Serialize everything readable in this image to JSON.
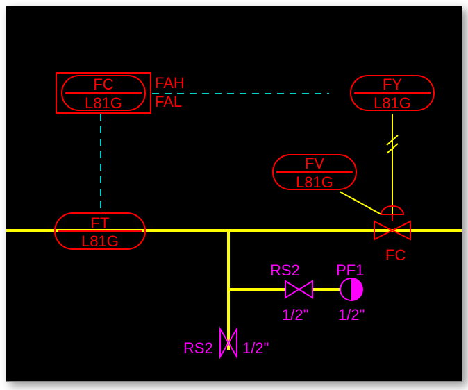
{
  "instruments": {
    "fc": {
      "type": "FC",
      "tag": "L81G"
    },
    "fy": {
      "type": "FY",
      "tag": "L81G"
    },
    "fv": {
      "type": "FV",
      "tag": "L81G"
    },
    "ft": {
      "type": "FT",
      "tag": "L81G"
    }
  },
  "alarms": {
    "fah": "FAH",
    "fal": "FAL"
  },
  "control_valve": {
    "fail_action": "FC"
  },
  "line_items": {
    "rs2_inline": {
      "label": "RS2",
      "size": "1/2\""
    },
    "pf1": {
      "label": "PF1",
      "size": "1/2\""
    },
    "rs2_drain": {
      "label": "RS2",
      "size": "1/2\""
    }
  }
}
